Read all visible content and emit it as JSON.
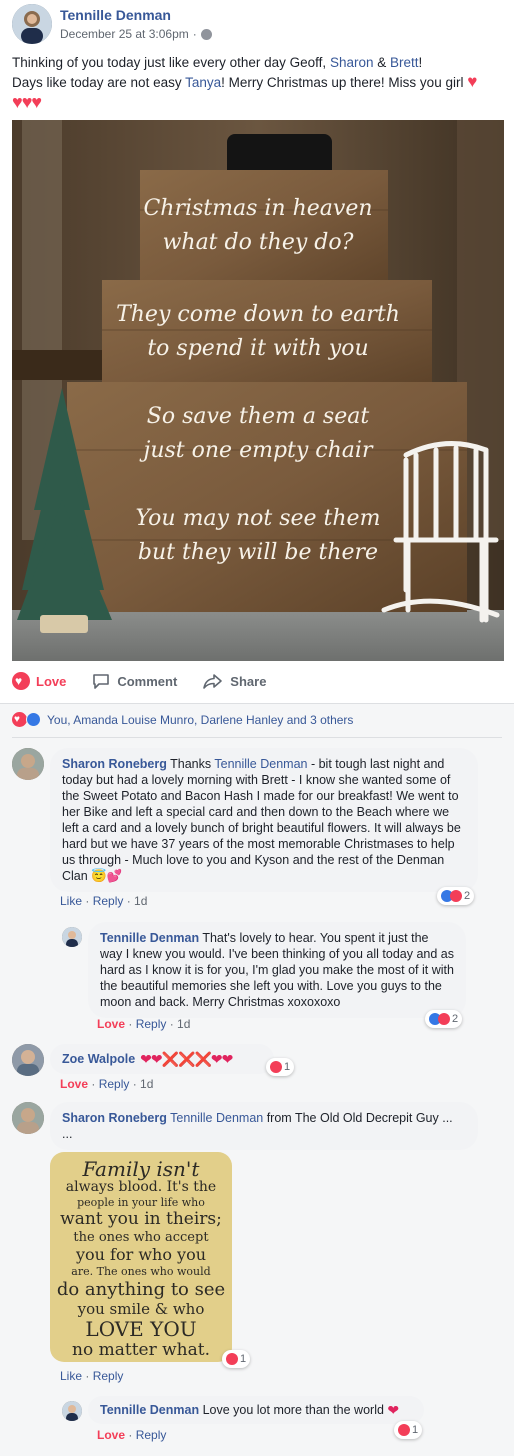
{
  "post": {
    "author": "Tennille Denman",
    "timestamp": "December 25 at 3:06pm",
    "privacy_sep": "·",
    "text": {
      "l1_a": "Thinking of you today just like every other day Geoff, ",
      "l1_tag1": "Sharon",
      "l1_amp": " & ",
      "l1_tag2": "Brett",
      "l1_end": "!",
      "l2_a": "Days like today are not easy ",
      "l2_tag": "Tanya",
      "l2_b": "! Merry Christmas up there! Miss you girl",
      "hearts_inline": "♥",
      "hearts_line": "♥♥♥"
    },
    "image_sign": {
      "line1": "Christmas in heaven",
      "line2": "what do they do?",
      "line3": "They come down to earth",
      "line4": "to spend it with you",
      "line5": "So save them a seat",
      "line6": "just one empty chair",
      "line7": "You may not see them",
      "line8": "but they will be there"
    }
  },
  "actions": {
    "love": "Love",
    "comment": "Comment",
    "share": "Share"
  },
  "reactions_summary": "You, Amanda Louise Munro, Darlene Hanley and 3 others",
  "comments": [
    {
      "author": "Sharon Roneberg",
      "text_a": " Thanks ",
      "tag": "Tennille Denman",
      "text_b": " - bit tough last night and today but had a lovely morning with Brett - I know she wanted some of the Sweet Potato and Bacon Hash I made for our breakfast! We went to her Bike and left a special card and then down to the Beach where we left a card and a lovely bunch of bright beautiful flowers. It will always be hard but we have 37 years of the most memorable Christmases to help us through - Much love to you and Kyson and the rest of the Denman Clan ",
      "emoji": "😇💕",
      "like": "Like",
      "reply": "Reply",
      "time": "1d",
      "react_count": "2"
    },
    {
      "author": "Tennille Denman",
      "text": " That's lovely to hear. You spent it just the way I knew you would. I've been thinking of you all today and as hard as I know it is for you, I'm glad you make the most of it with the beautiful memories she left you with. Love you guys to the moon and back. Merry Christmas xoxoxoxo",
      "love": "Love",
      "reply": "Reply",
      "time": "1d",
      "react_count": "2"
    },
    {
      "author": "Zoe Walpole",
      "text": "❤❤❌❌❌❤❤",
      "love": "Love",
      "reply": "Reply",
      "time": "1d",
      "react_count": "1"
    },
    {
      "author": "Sharon Roneberg",
      "tag": "Tennille Denman",
      "text": " from The Old Old Decrepit Guy ...",
      "text_2": "...",
      "like": "Like",
      "reply": "Reply",
      "react_count": "1",
      "quote": {
        "l1": "Family isn't",
        "l2": "always blood. It's the",
        "l3": "people in your life who",
        "l4": "want you in theirs;",
        "l5": "the ones who accept",
        "l6": "you for who you",
        "l7": "are. The ones who would",
        "l8": "do anything to see",
        "l9": "you smile & who",
        "l10": "LOVE YOU",
        "l11": "no matter what."
      }
    },
    {
      "author": "Tennille Denman",
      "text": " Love you lot more than the world ",
      "heart": "❤",
      "love": "Love",
      "reply": "Reply",
      "react_count": "1"
    }
  ],
  "meta_sep": " · ",
  "colors": {
    "link": "#385898",
    "love": "#f33e58",
    "like": "#3578e5",
    "bubble": "#f2f3f5",
    "comments_bg": "#f5f6f7"
  }
}
